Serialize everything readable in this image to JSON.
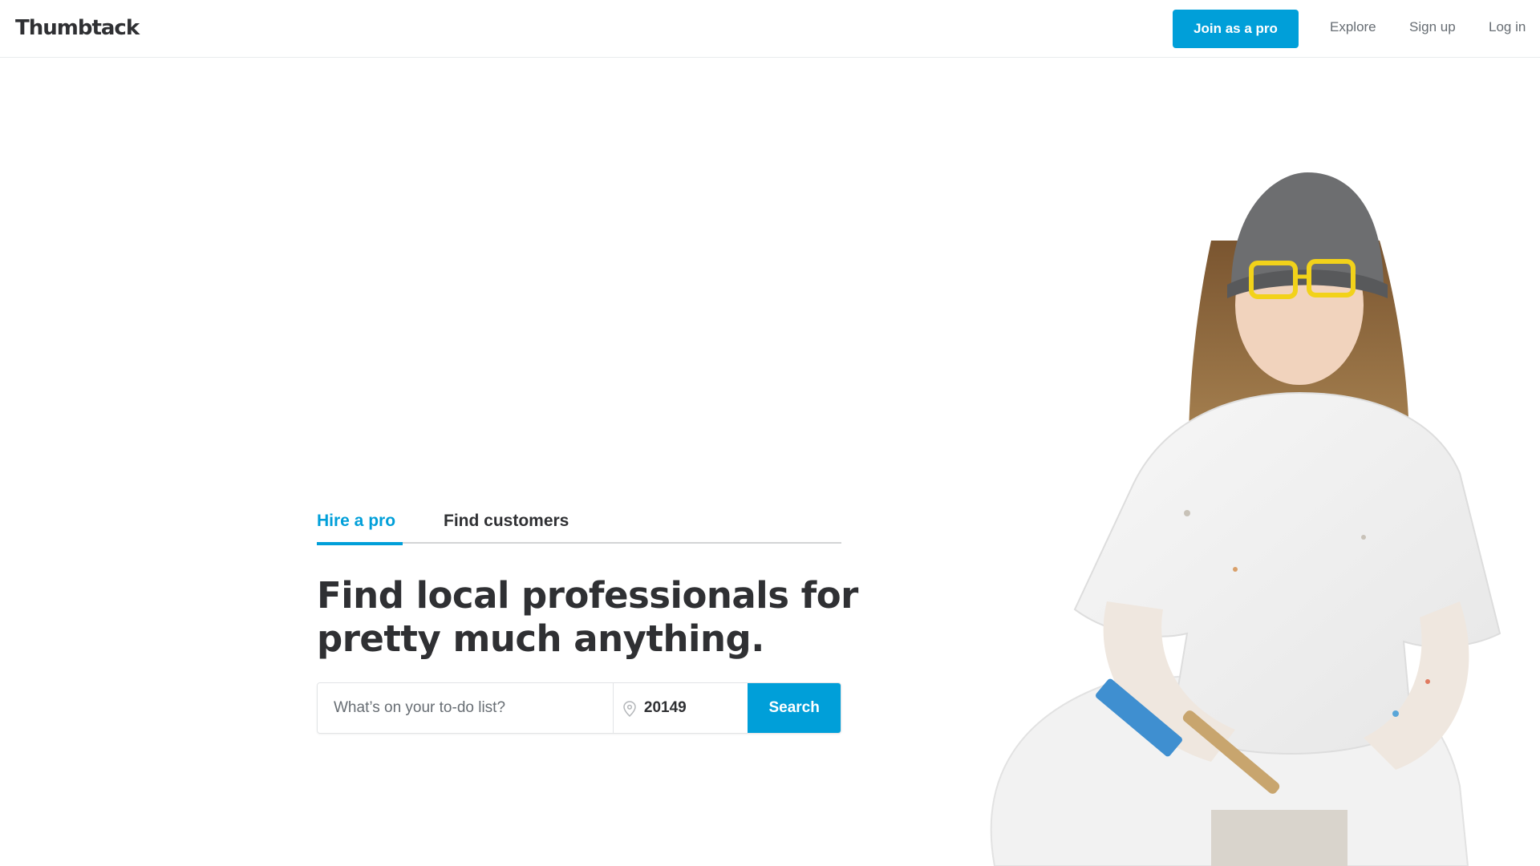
{
  "header": {
    "logo": "Thumbtack",
    "join_label": "Join as a pro",
    "nav": {
      "explore": "Explore",
      "signup": "Sign up",
      "login": "Log in"
    }
  },
  "tabs": {
    "hire": "Hire a pro",
    "find": "Find customers",
    "active": "hire"
  },
  "hero": {
    "headline_line1": "Find local professionals for",
    "headline_line2": "pretty much anything."
  },
  "search": {
    "todo_placeholder": "What’s on your to-do list?",
    "todo_value": "",
    "zip_value": "20149",
    "button_label": "Search"
  },
  "colors": {
    "accent": "#009fd9",
    "text": "#2f3033",
    "muted": "#676d73"
  },
  "icons": {
    "location": "location-pin-icon"
  }
}
